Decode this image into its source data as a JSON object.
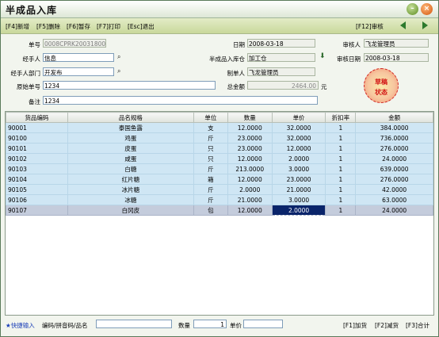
{
  "window": {
    "title": "半成品入库"
  },
  "toolbar": {
    "new": "[F4]新增",
    "delete": "[F5]删除",
    "hold": "[F6]暂存",
    "print": "[F7]打印",
    "exit": "[Esc]退出",
    "review": "[F12]审核",
    "prev_icon": "arrow-left-icon",
    "next_icon": "arrow-right-icon"
  },
  "form": {
    "doc_no_label": "单号",
    "doc_no_value": "0008CPRK2003180005",
    "handler_label": "经手人",
    "handler_value": "信息",
    "dept_label": "经手人部门",
    "dept_value": "开发布",
    "orig_no_label": "原始单号",
    "orig_no_value": "1234",
    "remark_label": "备注",
    "remark_value": "1234",
    "date_label": "日期",
    "date_value": "2008-03-18",
    "warehouse_label": "半成品入库仓",
    "warehouse_value": "加工仓",
    "creator_label": "制单人",
    "creator_value": "飞龙管理员",
    "total_label": "总金额",
    "total_value": "2464.00",
    "total_unit": "元",
    "auditor_label": "审核人",
    "auditor_value": "飞龙管理员",
    "audit_date_label": "审核日期",
    "audit_date_value": "2008-03-18",
    "stamp_line1": "草稿",
    "stamp_line2": "状态"
  },
  "grid": {
    "columns": [
      "货品编码",
      "品名规格",
      "单位",
      "数量",
      "单价",
      "折扣率",
      "金额"
    ],
    "rows": [
      [
        "90001",
        "泰国鱼露",
        "支",
        "12.0000",
        "32.0000",
        "1",
        "384.0000"
      ],
      [
        "90100",
        "鸡蛋",
        "斤",
        "23.0000",
        "32.0000",
        "1",
        "736.0000"
      ],
      [
        "90101",
        "皮蛋",
        "只",
        "23.0000",
        "12.0000",
        "1",
        "276.0000"
      ],
      [
        "90102",
        "咸蛋",
        "只",
        "12.0000",
        "2.0000",
        "1",
        "24.0000"
      ],
      [
        "90103",
        "白糖",
        "斤",
        "213.0000",
        "3.0000",
        "1",
        "639.0000"
      ],
      [
        "90104",
        "红片糖",
        "箱",
        "12.0000",
        "23.0000",
        "1",
        "276.0000"
      ],
      [
        "90105",
        "冰片糖",
        "斤",
        "2.0000",
        "21.0000",
        "1",
        "42.0000"
      ],
      [
        "90106",
        "冰糖",
        "斤",
        "21.0000",
        "3.0000",
        "1",
        "63.0000"
      ],
      [
        "90107",
        "白冈皮",
        "包",
        "12.0000",
        "2.0000",
        "1",
        "24.0000"
      ]
    ]
  },
  "status": {
    "quick_label": "★快捷输入",
    "quick_hint": "编码/拼音码/品名",
    "qty_label": "数量",
    "qty_value": "1",
    "price_label": "单价",
    "add": "[F1]加货",
    "reduce": "[F2]减货",
    "sum": "[F3]合计"
  }
}
